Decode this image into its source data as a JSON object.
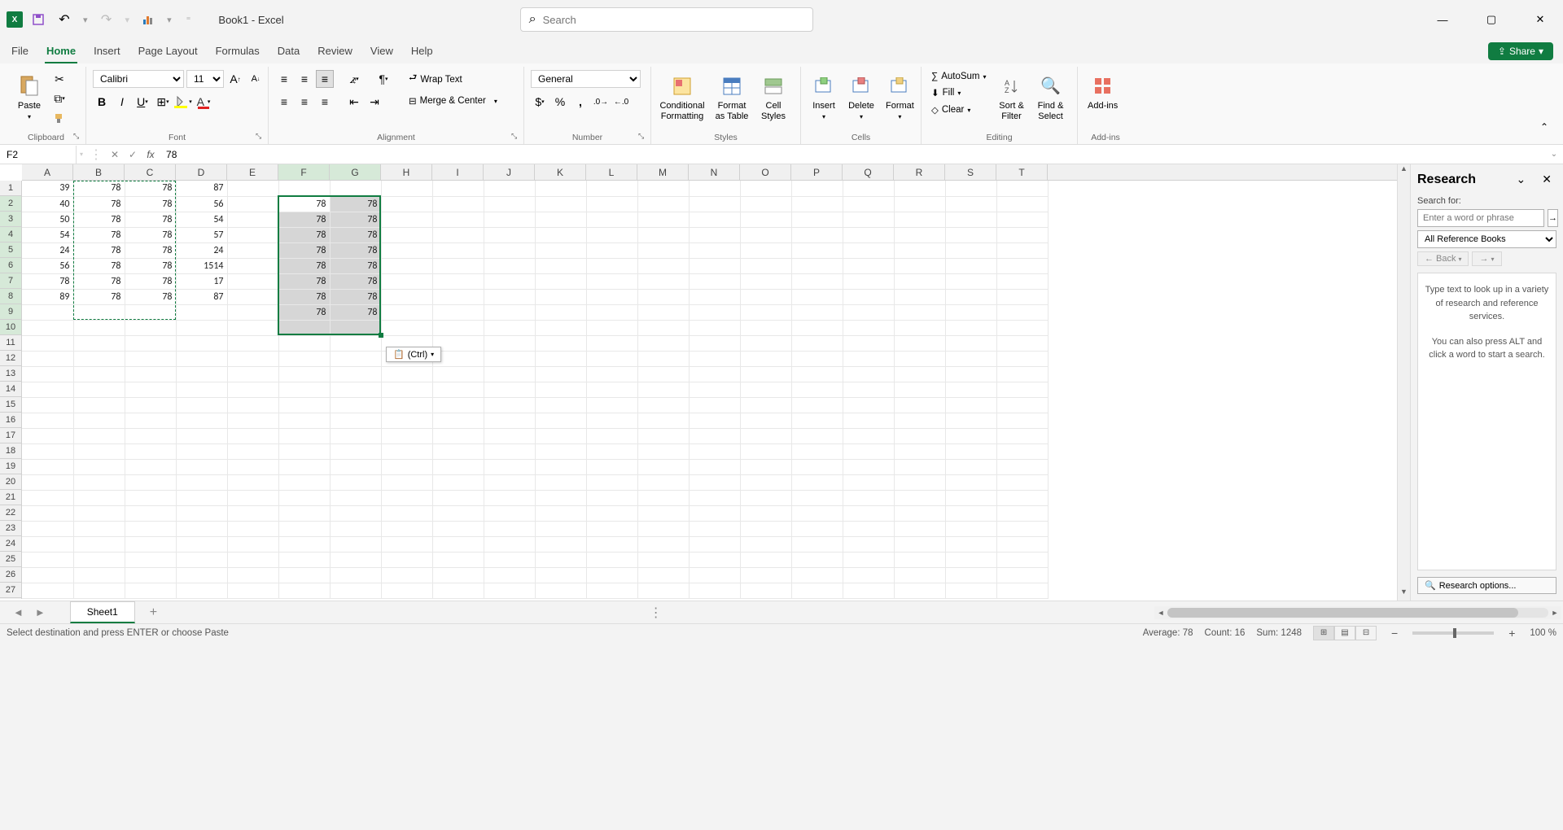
{
  "app": {
    "title": "Book1  -  Excel",
    "search_placeholder": "Search"
  },
  "tabs": {
    "file": "File",
    "home": "Home",
    "insert": "Insert",
    "page_layout": "Page Layout",
    "formulas": "Formulas",
    "data": "Data",
    "review": "Review",
    "view": "View",
    "help": "Help",
    "share": "Share"
  },
  "ribbon": {
    "clipboard": {
      "label": "Clipboard",
      "paste": "Paste"
    },
    "font": {
      "label": "Font",
      "family": "Calibri",
      "size": "11"
    },
    "alignment": {
      "label": "Alignment",
      "wrap": "Wrap Text",
      "merge": "Merge & Center"
    },
    "number": {
      "label": "Number",
      "format": "General"
    },
    "styles": {
      "label": "Styles",
      "cond": "Conditional Formatting",
      "table": "Format as Table",
      "cell": "Cell Styles"
    },
    "cells": {
      "label": "Cells",
      "insert": "Insert",
      "delete": "Delete",
      "format": "Format"
    },
    "editing": {
      "label": "Editing",
      "autosum": "AutoSum",
      "fill": "Fill",
      "clear": "Clear",
      "sort": "Sort & Filter",
      "find": "Find & Select"
    },
    "addins": {
      "label": "Add-ins",
      "btn": "Add-ins"
    }
  },
  "formula_bar": {
    "name_box": "F2",
    "formula": "78"
  },
  "columns": [
    "A",
    "B",
    "C",
    "D",
    "E",
    "F",
    "G",
    "H",
    "I",
    "J",
    "K",
    "L",
    "M",
    "N",
    "O",
    "P",
    "Q",
    "R",
    "S",
    "T"
  ],
  "rows": 27,
  "cells": {
    "A1": "39",
    "A2": "40",
    "A3": "50",
    "A4": "54",
    "A5": "24",
    "A6": "56",
    "A7": "78",
    "A8": "89",
    "B1": "78",
    "B2": "78",
    "B3": "78",
    "B4": "78",
    "B5": "78",
    "B6": "78",
    "B7": "78",
    "B8": "78",
    "C1": "78",
    "C2": "78",
    "C3": "78",
    "C4": "78",
    "C5": "78",
    "C6": "78",
    "C7": "78",
    "C8": "78",
    "D1": "87",
    "D2": "56",
    "D3": "54",
    "D4": "57",
    "D5": "24",
    "D6": "1514",
    "D7": "17",
    "D8": "87",
    "F2": "78",
    "F3": "78",
    "F4": "78",
    "F5": "78",
    "F6": "78",
    "F7": "78",
    "F8": "78",
    "F9": "78",
    "G2": "78",
    "G3": "78",
    "G4": "78",
    "G5": "78",
    "G6": "78",
    "G7": "78",
    "G8": "78",
    "G9": "78"
  },
  "copied_range": "B1:C9",
  "selection": "F2:G10",
  "active_cell": "F2",
  "paste_options_label": "(Ctrl)",
  "research": {
    "title": "Research",
    "search_for": "Search for:",
    "placeholder": "Enter a word or phrase",
    "source": "All Reference Books",
    "back": "Back",
    "hint1": "Type text to look up in a variety of research and reference services.",
    "hint2": "You can also press ALT and click a word to start a search.",
    "options": "Research options..."
  },
  "sheets": {
    "active": "Sheet1"
  },
  "status": {
    "msg": "Select destination and press ENTER or choose Paste",
    "avg": "Average: 78",
    "count": "Count: 16",
    "sum": "Sum: 1248",
    "zoom": "100 %"
  }
}
